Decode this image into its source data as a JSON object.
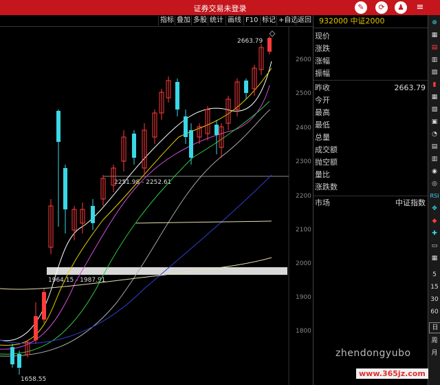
{
  "titlebar": {
    "title": "证券交易未登录"
  },
  "toolbar": {
    "buttons": [
      "指标",
      "叠加",
      "多股",
      "统计",
      "画线",
      "F10",
      "标记",
      "+自选",
      "返回"
    ]
  },
  "quote": {
    "header": "932000 中证2000",
    "rows": [
      {
        "k": "现价",
        "v": ""
      },
      {
        "k": "涨跌",
        "v": ""
      },
      {
        "k": "涨幅",
        "v": ""
      },
      {
        "k": "振幅",
        "v": ""
      },
      {
        "k": "昨收",
        "v": "2663.79"
      },
      {
        "k": "今开",
        "v": ""
      },
      {
        "k": "最高",
        "v": ""
      },
      {
        "k": "最低",
        "v": ""
      },
      {
        "k": "总量",
        "v": ""
      },
      {
        "k": "成交额",
        "v": ""
      },
      {
        "k": "抛空额",
        "v": ""
      },
      {
        "k": "量比",
        "v": ""
      },
      {
        "k": "涨跌数",
        "v": ""
      },
      {
        "k": "市场",
        "v": "中证指数"
      }
    ]
  },
  "chart": {
    "ticks": [
      "2600",
      "2500",
      "2400",
      "2300",
      "2200",
      "2100",
      "2000",
      "1900",
      "1800"
    ],
    "high_label": "2663.79",
    "low_label": "1658.55",
    "zone1": "2251.98 - 2252.61",
    "zone2": "1964.15 - 1987.91"
  },
  "sidebar": {
    "items": [
      "RSI",
      "5",
      "15",
      "30",
      "60",
      "日",
      "周",
      "月"
    ]
  },
  "watermark": {
    "line1": "zhendongyubo",
    "line2": "www.365jz.com"
  },
  "colors": {
    "up": "#ff3b3b",
    "down": "#3ad7e6",
    "ma5": "#ffffff",
    "ma10": "#e5d400",
    "ma20": "#d24bd8",
    "ma30": "#2ecc40",
    "ma60": "#aaaaaa",
    "ma120": "#2f3fd0"
  }
}
